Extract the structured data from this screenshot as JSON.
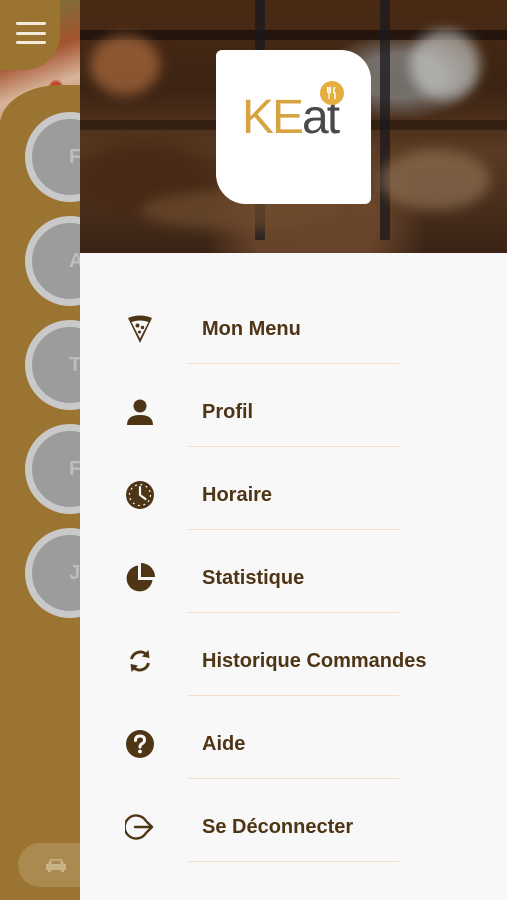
{
  "app": {
    "logo_part1": "KE",
    "logo_part2": "at"
  },
  "background": {
    "avatars": [
      "F",
      "A",
      "T",
      "F",
      "J"
    ],
    "colors": {
      "strip": "#9a7430",
      "avatar": "#9c9c9c"
    }
  },
  "menu": {
    "items": [
      {
        "label": "Mon Menu",
        "icon": "pizza-slice-icon"
      },
      {
        "label": "Profil",
        "icon": "user-icon"
      },
      {
        "label": "Horaire",
        "icon": "clock-icon"
      },
      {
        "label": "Statistique",
        "icon": "pie-chart-icon"
      },
      {
        "label": "Historique Commandes",
        "icon": "sync-icon"
      },
      {
        "label": "Aide",
        "icon": "help-circle-icon"
      },
      {
        "label": "Se Déconnecter",
        "icon": "logout-icon"
      }
    ]
  },
  "colors": {
    "accent": "#9a7430",
    "text": "#4e3516",
    "divider": "#eedfc6",
    "logo_gold": "#d7a441"
  }
}
